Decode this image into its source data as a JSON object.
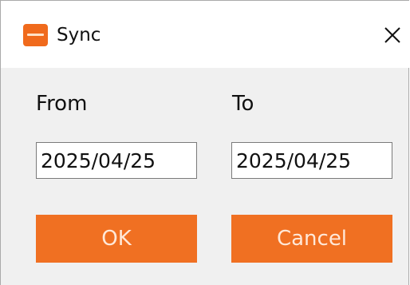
{
  "window": {
    "title": "Sync",
    "app_icon": "app-logo-icon",
    "close_icon": "close-icon",
    "close_glyph": "✕"
  },
  "form": {
    "from_label": "From",
    "to_label": "To",
    "from_value": "2025/04/25",
    "to_value": "2025/04/25"
  },
  "actions": {
    "ok_label": "OK",
    "cancel_label": "Cancel"
  },
  "colors": {
    "accent": "#f07022",
    "button_text": "#ffe8d8",
    "dialog_background": "#f0f0f0",
    "titlebar_background": "#ffffff"
  }
}
